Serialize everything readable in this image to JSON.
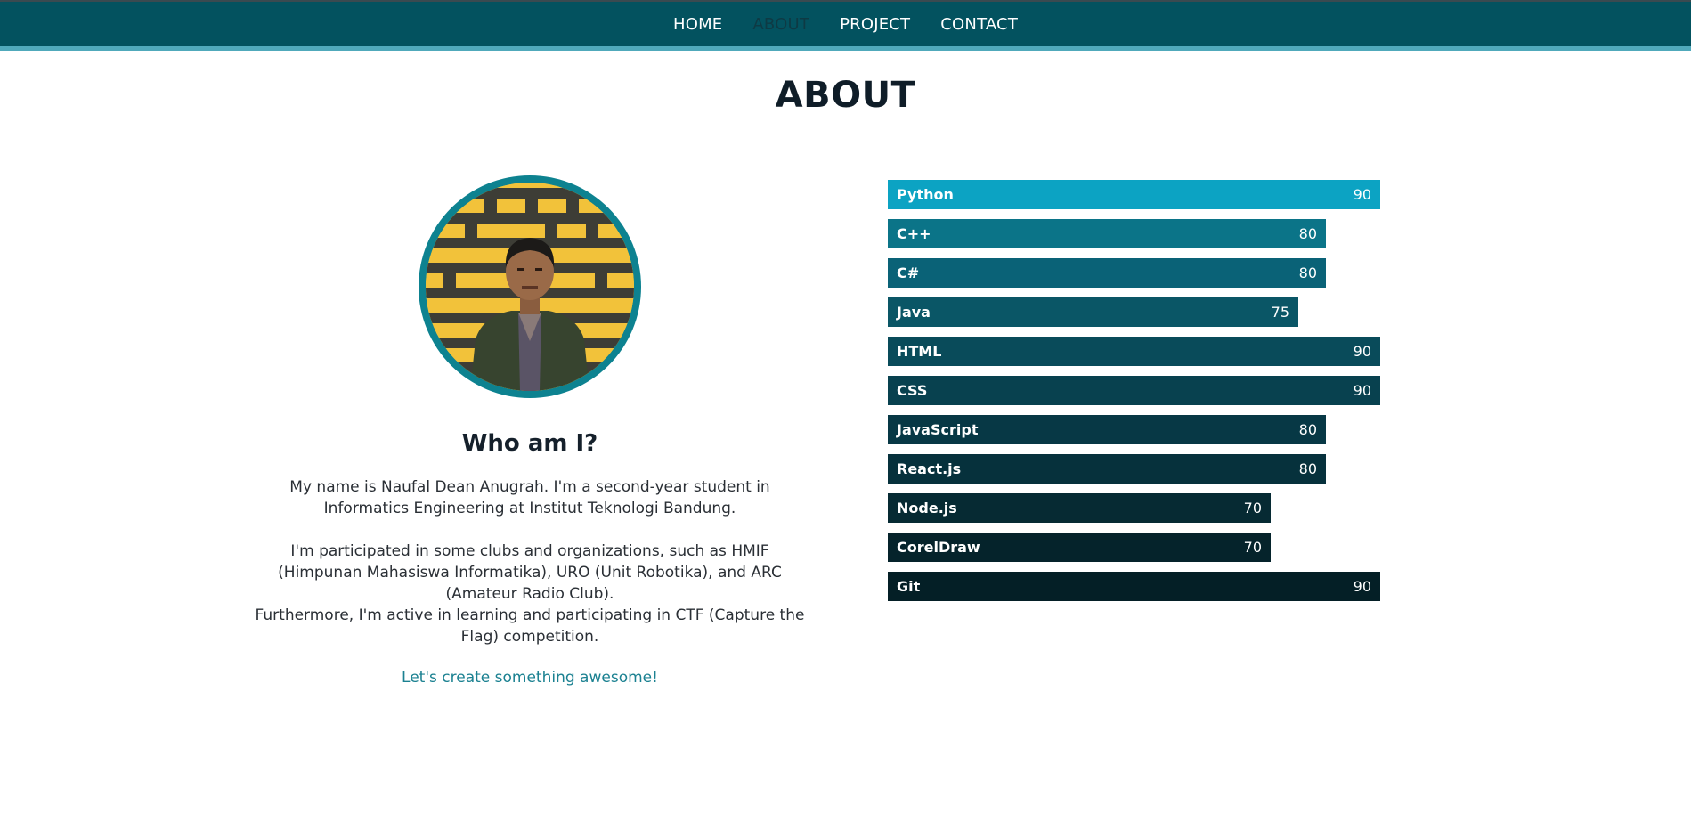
{
  "nav": {
    "items": [
      {
        "label": "HOME",
        "active": false
      },
      {
        "label": "ABOUT",
        "active": true
      },
      {
        "label": "PROJECT",
        "active": false
      },
      {
        "label": "CONTACT",
        "active": false
      }
    ]
  },
  "page": {
    "title": "ABOUT"
  },
  "profile": {
    "heading": "Who am I?",
    "bio_1": "My name is Naufal Dean Anugrah. I'm a second-year student in Informatics Engineering at Institut Teknologi Bandung.",
    "bio_2": "I'm participated in some clubs and organizations, such as HMIF (Himpunan Mahasiswa Informatika), URO (Unit Robotika), and ARC (Amateur Radio Club).",
    "bio_3": "Furthermore, I'm active in learning and participating in CTF (Capture the Flag) competition.",
    "cta": "Let's create something awesome!"
  },
  "skills": {
    "max": 100,
    "items": [
      {
        "name": "Python",
        "value": 90,
        "color": "#0ca3c3"
      },
      {
        "name": "C++",
        "value": 80,
        "color": "#0b7488"
      },
      {
        "name": "C#",
        "value": 80,
        "color": "#0a6277"
      },
      {
        "name": "Java",
        "value": 75,
        "color": "#0a5666"
      },
      {
        "name": "HTML",
        "value": 90,
        "color": "#094b5a"
      },
      {
        "name": "CSS",
        "value": 90,
        "color": "#08414f"
      },
      {
        "name": "JavaScript",
        "value": 80,
        "color": "#073845"
      },
      {
        "name": "React.js",
        "value": 80,
        "color": "#06313c"
      },
      {
        "name": "Node.js",
        "value": 70,
        "color": "#062a33"
      },
      {
        "name": "CorelDraw",
        "value": 70,
        "color": "#05232b"
      },
      {
        "name": "Git",
        "value": 90,
        "color": "#041f26"
      }
    ]
  },
  "colors": {
    "navbar": "#03525f",
    "navbar_border": "#50a9bb",
    "accent": "#1b8191"
  }
}
